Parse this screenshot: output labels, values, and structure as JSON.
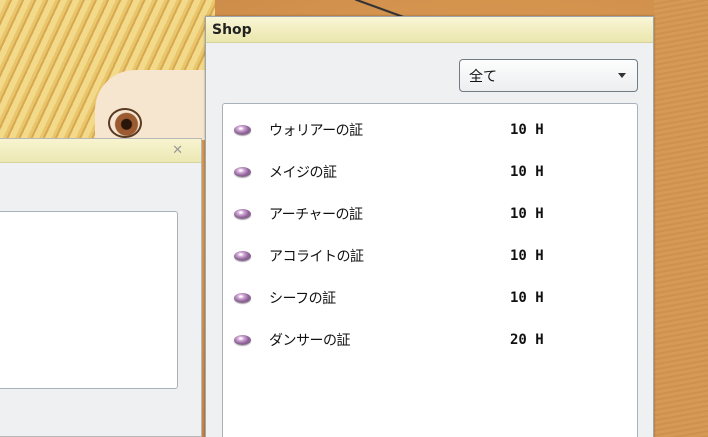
{
  "shop": {
    "title": "Shop",
    "filter": {
      "selected": "全て"
    },
    "items": [
      {
        "name": "ウォリアーの証",
        "price": "10 H"
      },
      {
        "name": "メイジの証",
        "price": "10 H"
      },
      {
        "name": "アーチャーの証",
        "price": "10 H"
      },
      {
        "name": "アコライトの証",
        "price": "10 H"
      },
      {
        "name": "シーフの証",
        "price": "10 H"
      },
      {
        "name": "ダンサーの証",
        "price": "20 H"
      }
    ]
  },
  "left_dialog": {
    "close_glyph": "✕"
  },
  "icons": {
    "item": "gem-icon",
    "dropdown": "chevron-down-icon",
    "close": "close-icon"
  }
}
